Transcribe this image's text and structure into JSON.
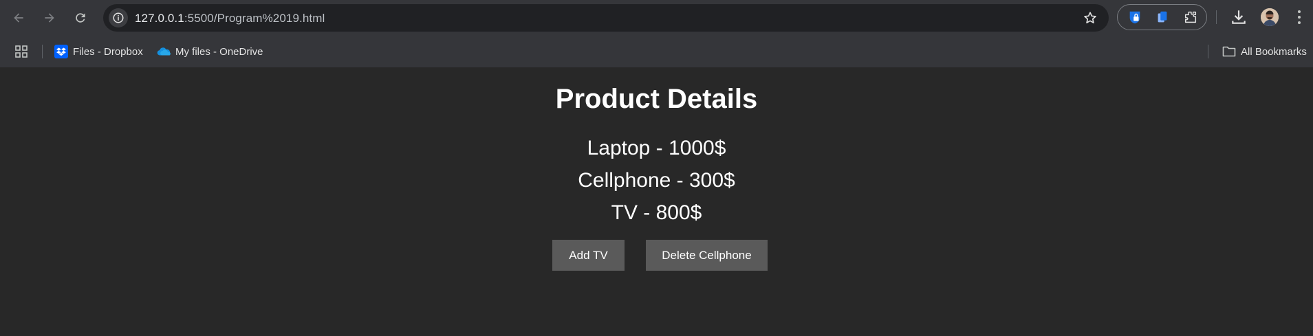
{
  "browser": {
    "url_host": "127.0.0.1",
    "url_rest": ":5500/Program%2019.html",
    "icons": {
      "back": "arrow-left-icon",
      "forward": "arrow-right-icon",
      "reload": "reload-icon",
      "site_info": "info-icon",
      "bookmark_star": "star-icon",
      "download": "download-icon",
      "menu": "kebab-menu-icon"
    }
  },
  "bookmarks": {
    "items": [
      {
        "label": "Files - Dropbox",
        "icon": "dropbox-icon"
      },
      {
        "label": "My files - OneDrive",
        "icon": "onedrive-icon"
      }
    ],
    "all_bookmarks_label": "All Bookmarks"
  },
  "page": {
    "title": "Product Details",
    "products": [
      "Laptop - 1000$",
      "Cellphone - 300$",
      "TV - 800$"
    ],
    "buttons": {
      "add_tv": "Add TV",
      "delete_cellphone": "Delete Cellphone"
    }
  },
  "colors": {
    "page_bg": "#282828",
    "chrome_bg": "#35363a",
    "omnibox_bg": "#202124",
    "button_bg": "#5a5a5a",
    "text": "#ffffff"
  }
}
